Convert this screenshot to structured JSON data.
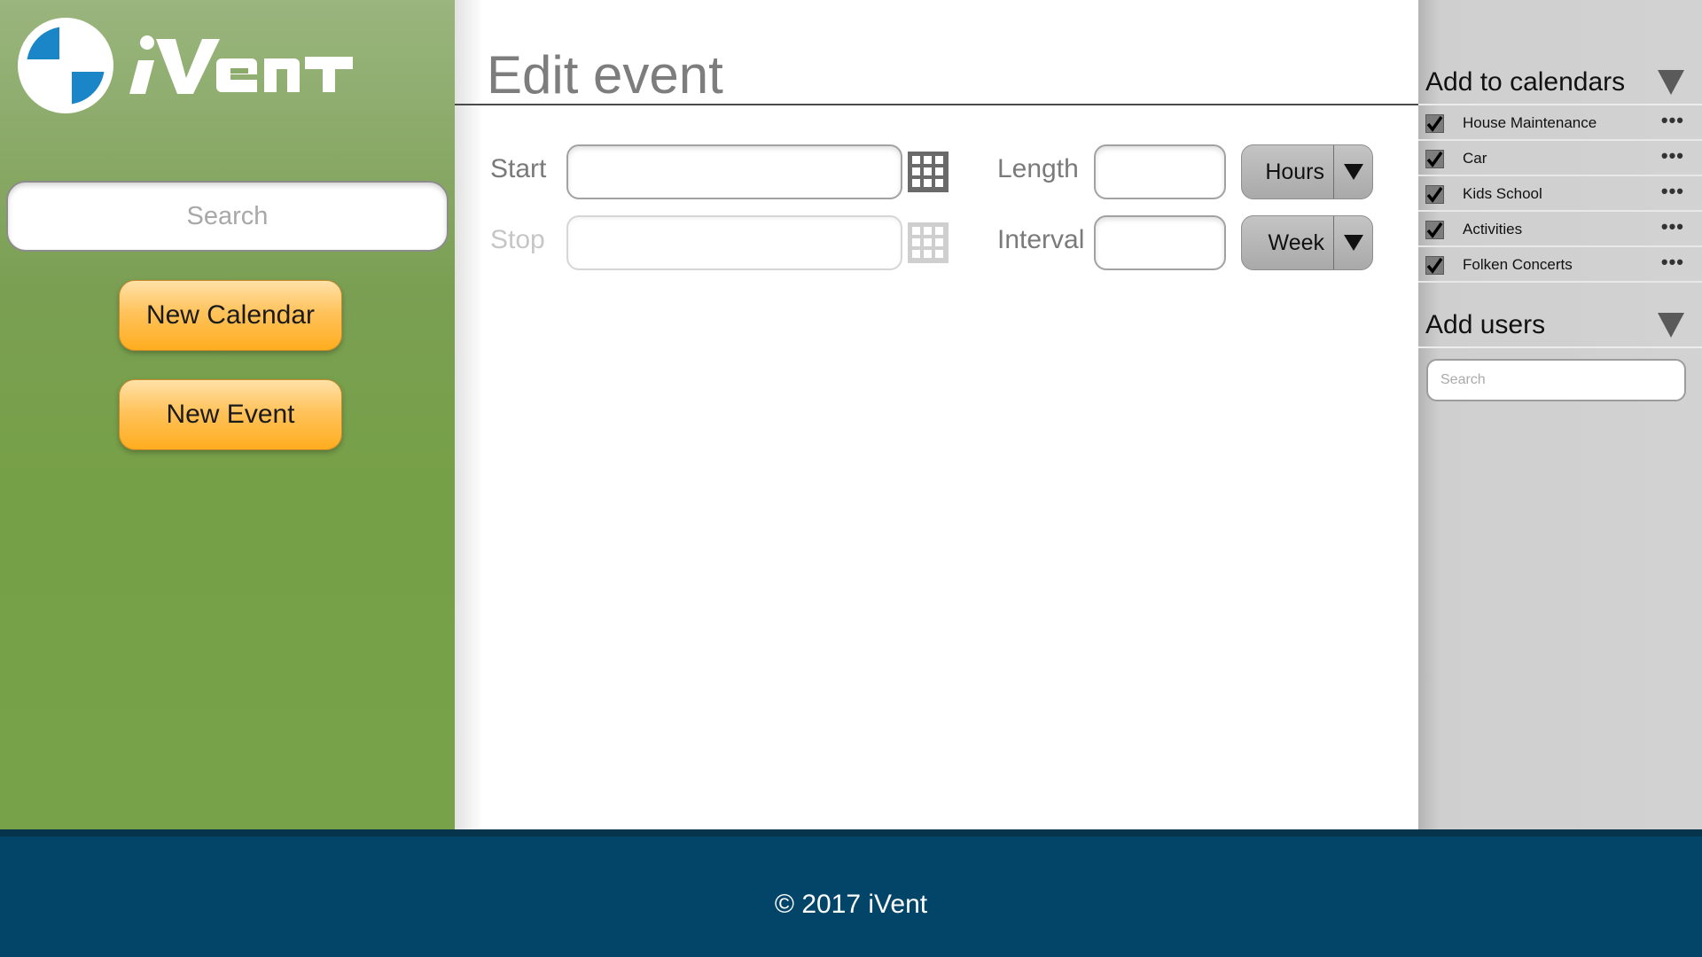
{
  "brand": {
    "name": "iVent"
  },
  "sidebar": {
    "search_placeholder": "Search",
    "new_calendar_label": "New Calendar",
    "new_event_label": "New Event"
  },
  "main": {
    "title": "Edit event",
    "start_label": "Start",
    "stop_label": "Stop",
    "length_label": "Length",
    "interval_label": "Interval",
    "length_unit": "Hours",
    "interval_unit": "Week"
  },
  "calendars_panel": {
    "title": "Add to calendars",
    "items": [
      {
        "label": "House Maintenance",
        "checked": true
      },
      {
        "label": "Car",
        "checked": true
      },
      {
        "label": "Kids School",
        "checked": true
      },
      {
        "label": "Activities",
        "checked": true
      },
      {
        "label": "Folken Concerts",
        "checked": true
      }
    ],
    "more_glyph": "•••"
  },
  "users_panel": {
    "title": "Add users",
    "search_placeholder": "Search"
  },
  "footer": {
    "copyright": "© 2017 iVent"
  },
  "colors": {
    "sidebar_green": "#78a24a",
    "button_orange": "#ffad1f",
    "footer_blue": "#024568",
    "logo_blue": "#1a86c8"
  }
}
